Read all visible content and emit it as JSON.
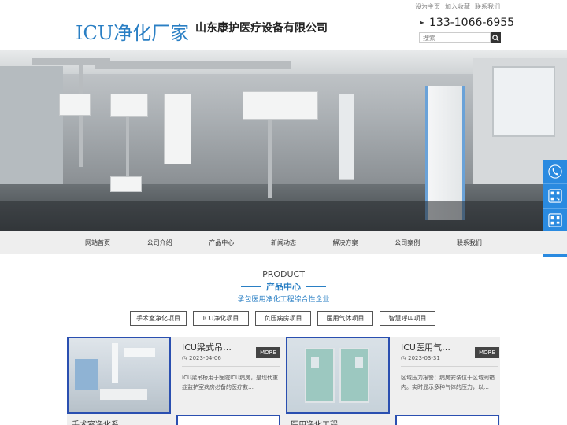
{
  "header": {
    "logo": "ICU净化厂家",
    "company": "山东康护医疗设备有限公司",
    "toplinks": [
      "设为主页",
      "加入收藏",
      "联系我们"
    ],
    "phone": "133-1066-6955",
    "search_placeholder": "搜索"
  },
  "nav": {
    "items": [
      "网站首页",
      "公司介绍",
      "产品中心",
      "新闻动态",
      "解决方案",
      "公司案例",
      "联系我们"
    ]
  },
  "section": {
    "title_en": "PRODUCT",
    "title_cn": "产品中心",
    "subtitle": "承包医用净化工程综合性企业"
  },
  "categories": [
    "手术室净化项目",
    "ICU净化项目",
    "负压病房项目",
    "医用气体项目",
    "智慧呼叫项目"
  ],
  "products": [
    {
      "title": "ICU梁式吊…",
      "more": "MORE",
      "date": "2023-04-06",
      "desc": "ICU梁吊桥用于医院ICU病房，是现代重症监护室病房必备的医疗救…",
      "image_caption": "手术室净化系…"
    },
    {
      "title": "ICU医用气…",
      "more": "MORE",
      "date": "2023-03-31",
      "desc": "区域压力报警：病房安装位于区域阀箱内。实时显示多种气体的压力，以…",
      "image_caption": "医用净化工程…"
    }
  ],
  "sidebar_icons": [
    "phone-icon",
    "qrcode-icon",
    "qrcode-icon",
    "back-to-top-icon"
  ],
  "colors": {
    "accent": "#2a7fc4",
    "sidebar": "#2a8ae0",
    "more": "#444444"
  }
}
